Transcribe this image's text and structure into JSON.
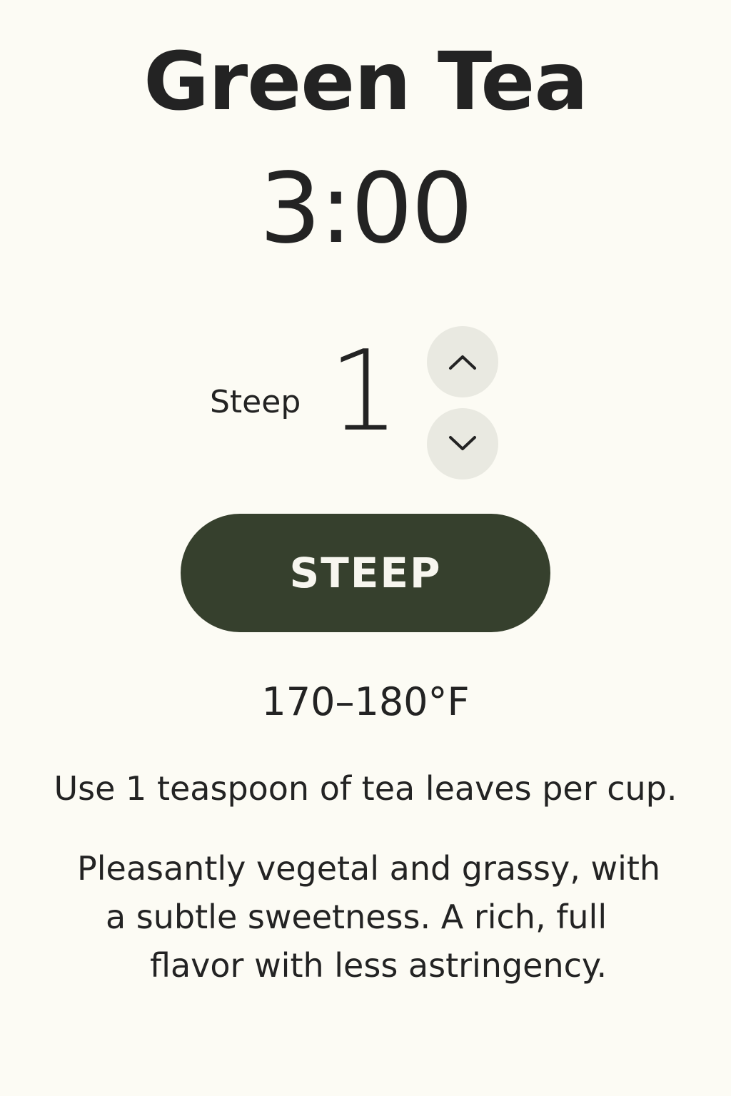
{
  "tea": {
    "name": "Green Tea",
    "timer": "3:00"
  },
  "steep": {
    "label": "Steep",
    "count": "1",
    "increment_icon": "chevron-up-icon",
    "decrement_icon": "chevron-down-icon"
  },
  "action": {
    "steep_button_label": "STEEP"
  },
  "details": {
    "temperature": "170–180°F",
    "instructions": "Use 1 teaspoon of tea leaves per cup.",
    "description_lines": [
      "Pleasantly vegetal and grassy, with",
      "a subtle sweetness. A rich, full",
      "flavor with less astringency."
    ]
  },
  "colors": {
    "background": "#fcfbf4",
    "text": "#232323",
    "button": "#36402d",
    "button_text": "#f7f6ef",
    "stepper": "#e9e9e1"
  }
}
